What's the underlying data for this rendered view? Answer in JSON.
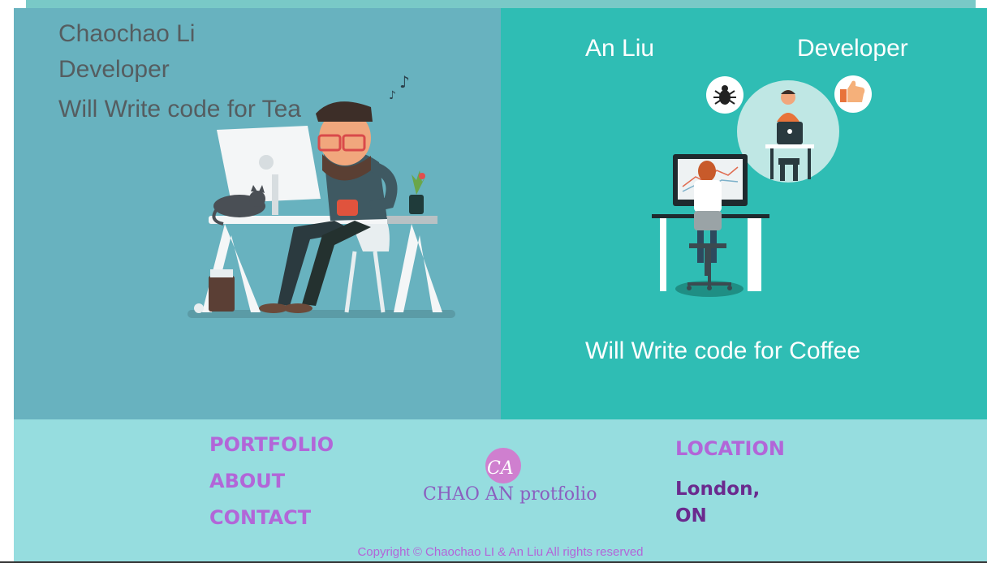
{
  "left_profile": {
    "name": "Chaochao Li",
    "role": "Developer",
    "tagline": "Will Write code for Tea"
  },
  "right_profile": {
    "name": "An Liu",
    "role": "Developer",
    "tagline": "Will Write code for Coffee"
  },
  "footer": {
    "nav": {
      "portfolio": "PORTFOLIO",
      "about": "ABOUT",
      "contact": "CONTACT"
    },
    "logo": {
      "mark": "CA",
      "text": "CHAO AN protfolio"
    },
    "location": {
      "title": "LOCATION",
      "value": "London, ON"
    },
    "copyright": "Copyright © Chaochao LI & An Liu All rights reserved"
  },
  "colors": {
    "left_panel": "#68b2bf",
    "right_panel": "#2fbdb4",
    "footer": "#96dddf",
    "accent": "#b266d8"
  }
}
